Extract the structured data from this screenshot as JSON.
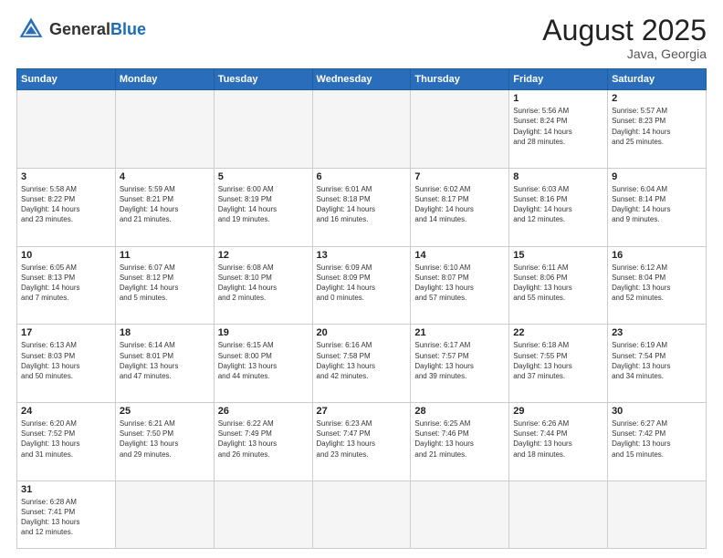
{
  "header": {
    "logo_general": "General",
    "logo_blue": "Blue",
    "title": "August 2025",
    "location": "Java, Georgia"
  },
  "days_of_week": [
    "Sunday",
    "Monday",
    "Tuesday",
    "Wednesday",
    "Thursday",
    "Friday",
    "Saturday"
  ],
  "weeks": [
    [
      {
        "num": "",
        "info": ""
      },
      {
        "num": "",
        "info": ""
      },
      {
        "num": "",
        "info": ""
      },
      {
        "num": "",
        "info": ""
      },
      {
        "num": "",
        "info": ""
      },
      {
        "num": "1",
        "info": "Sunrise: 5:56 AM\nSunset: 8:24 PM\nDaylight: 14 hours\nand 28 minutes."
      },
      {
        "num": "2",
        "info": "Sunrise: 5:57 AM\nSunset: 8:23 PM\nDaylight: 14 hours\nand 25 minutes."
      }
    ],
    [
      {
        "num": "3",
        "info": "Sunrise: 5:58 AM\nSunset: 8:22 PM\nDaylight: 14 hours\nand 23 minutes."
      },
      {
        "num": "4",
        "info": "Sunrise: 5:59 AM\nSunset: 8:21 PM\nDaylight: 14 hours\nand 21 minutes."
      },
      {
        "num": "5",
        "info": "Sunrise: 6:00 AM\nSunset: 8:19 PM\nDaylight: 14 hours\nand 19 minutes."
      },
      {
        "num": "6",
        "info": "Sunrise: 6:01 AM\nSunset: 8:18 PM\nDaylight: 14 hours\nand 16 minutes."
      },
      {
        "num": "7",
        "info": "Sunrise: 6:02 AM\nSunset: 8:17 PM\nDaylight: 14 hours\nand 14 minutes."
      },
      {
        "num": "8",
        "info": "Sunrise: 6:03 AM\nSunset: 8:16 PM\nDaylight: 14 hours\nand 12 minutes."
      },
      {
        "num": "9",
        "info": "Sunrise: 6:04 AM\nSunset: 8:14 PM\nDaylight: 14 hours\nand 9 minutes."
      }
    ],
    [
      {
        "num": "10",
        "info": "Sunrise: 6:05 AM\nSunset: 8:13 PM\nDaylight: 14 hours\nand 7 minutes."
      },
      {
        "num": "11",
        "info": "Sunrise: 6:07 AM\nSunset: 8:12 PM\nDaylight: 14 hours\nand 5 minutes."
      },
      {
        "num": "12",
        "info": "Sunrise: 6:08 AM\nSunset: 8:10 PM\nDaylight: 14 hours\nand 2 minutes."
      },
      {
        "num": "13",
        "info": "Sunrise: 6:09 AM\nSunset: 8:09 PM\nDaylight: 14 hours\nand 0 minutes."
      },
      {
        "num": "14",
        "info": "Sunrise: 6:10 AM\nSunset: 8:07 PM\nDaylight: 13 hours\nand 57 minutes."
      },
      {
        "num": "15",
        "info": "Sunrise: 6:11 AM\nSunset: 8:06 PM\nDaylight: 13 hours\nand 55 minutes."
      },
      {
        "num": "16",
        "info": "Sunrise: 6:12 AM\nSunset: 8:04 PM\nDaylight: 13 hours\nand 52 minutes."
      }
    ],
    [
      {
        "num": "17",
        "info": "Sunrise: 6:13 AM\nSunset: 8:03 PM\nDaylight: 13 hours\nand 50 minutes."
      },
      {
        "num": "18",
        "info": "Sunrise: 6:14 AM\nSunset: 8:01 PM\nDaylight: 13 hours\nand 47 minutes."
      },
      {
        "num": "19",
        "info": "Sunrise: 6:15 AM\nSunset: 8:00 PM\nDaylight: 13 hours\nand 44 minutes."
      },
      {
        "num": "20",
        "info": "Sunrise: 6:16 AM\nSunset: 7:58 PM\nDaylight: 13 hours\nand 42 minutes."
      },
      {
        "num": "21",
        "info": "Sunrise: 6:17 AM\nSunset: 7:57 PM\nDaylight: 13 hours\nand 39 minutes."
      },
      {
        "num": "22",
        "info": "Sunrise: 6:18 AM\nSunset: 7:55 PM\nDaylight: 13 hours\nand 37 minutes."
      },
      {
        "num": "23",
        "info": "Sunrise: 6:19 AM\nSunset: 7:54 PM\nDaylight: 13 hours\nand 34 minutes."
      }
    ],
    [
      {
        "num": "24",
        "info": "Sunrise: 6:20 AM\nSunset: 7:52 PM\nDaylight: 13 hours\nand 31 minutes."
      },
      {
        "num": "25",
        "info": "Sunrise: 6:21 AM\nSunset: 7:50 PM\nDaylight: 13 hours\nand 29 minutes."
      },
      {
        "num": "26",
        "info": "Sunrise: 6:22 AM\nSunset: 7:49 PM\nDaylight: 13 hours\nand 26 minutes."
      },
      {
        "num": "27",
        "info": "Sunrise: 6:23 AM\nSunset: 7:47 PM\nDaylight: 13 hours\nand 23 minutes."
      },
      {
        "num": "28",
        "info": "Sunrise: 6:25 AM\nSunset: 7:46 PM\nDaylight: 13 hours\nand 21 minutes."
      },
      {
        "num": "29",
        "info": "Sunrise: 6:26 AM\nSunset: 7:44 PM\nDaylight: 13 hours\nand 18 minutes."
      },
      {
        "num": "30",
        "info": "Sunrise: 6:27 AM\nSunset: 7:42 PM\nDaylight: 13 hours\nand 15 minutes."
      }
    ],
    [
      {
        "num": "31",
        "info": "Sunrise: 6:28 AM\nSunset: 7:41 PM\nDaylight: 13 hours\nand 12 minutes."
      },
      {
        "num": "",
        "info": ""
      },
      {
        "num": "",
        "info": ""
      },
      {
        "num": "",
        "info": ""
      },
      {
        "num": "",
        "info": ""
      },
      {
        "num": "",
        "info": ""
      },
      {
        "num": "",
        "info": ""
      }
    ]
  ]
}
